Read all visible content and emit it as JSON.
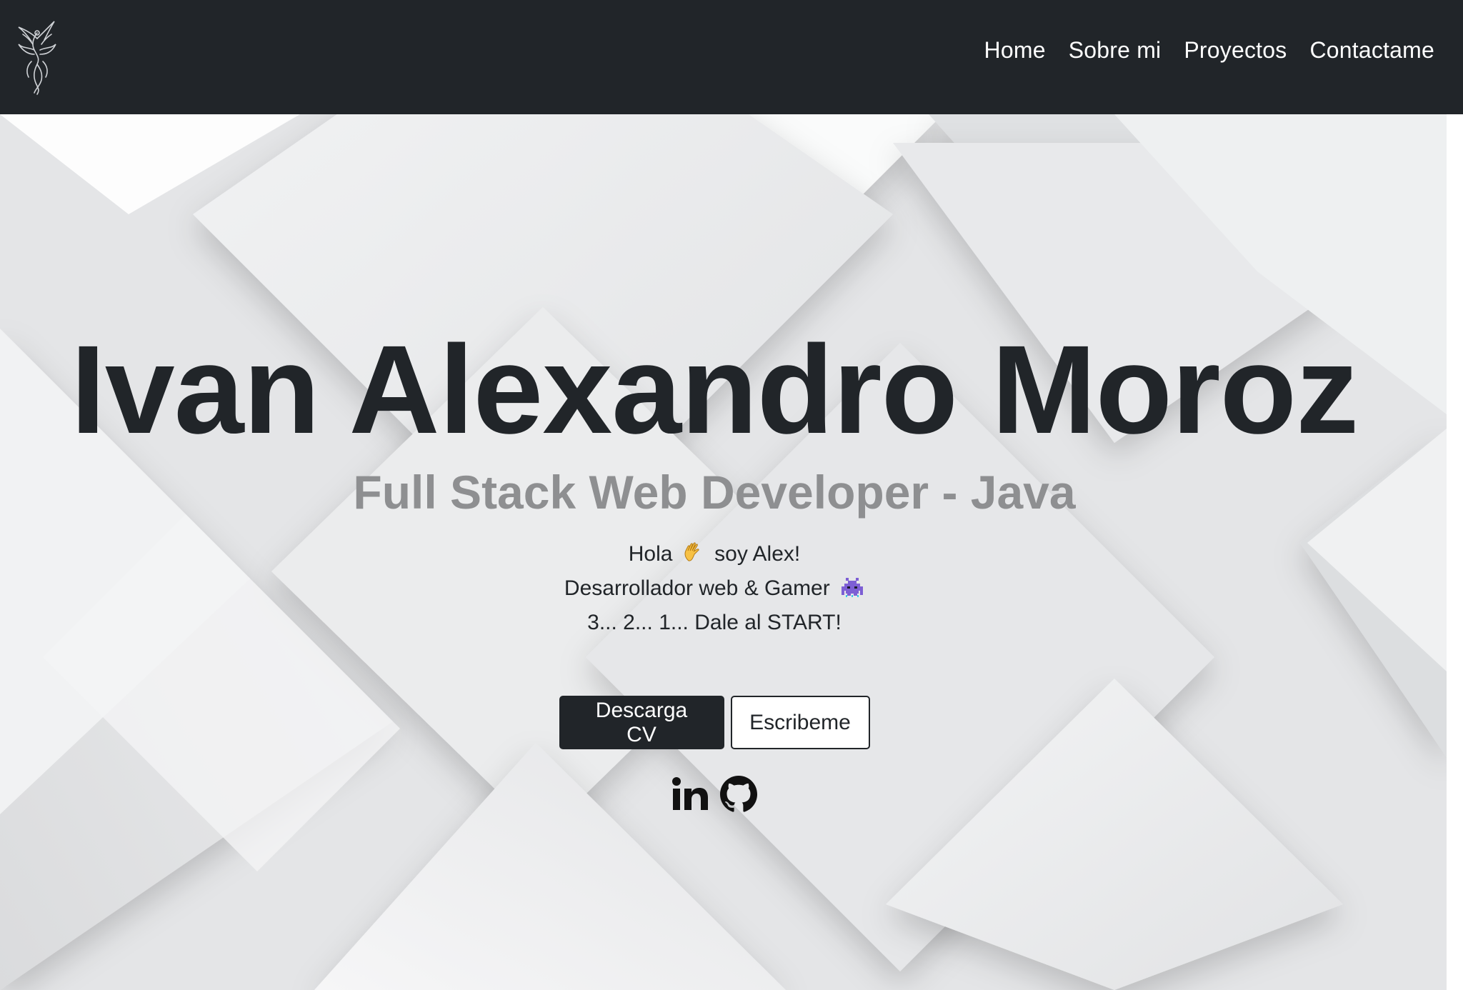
{
  "navbar": {
    "logo": "phoenix-logo",
    "links": [
      {
        "label": "Home"
      },
      {
        "label": "Sobre mi"
      },
      {
        "label": "Proyectos"
      },
      {
        "label": "Contactame"
      }
    ]
  },
  "hero": {
    "title": "Ivan Alexandro Moroz",
    "subtitle": "Full Stack Web Developer - Java",
    "intro": {
      "line1_before": "Hola",
      "line1_after": "soy Alex!",
      "line2": "Desarrollador web & Gamer",
      "line3": "3... 2... 1... Dale al START!"
    },
    "buttons": {
      "download_cv": "Descarga CV",
      "write_me": "Escribeme"
    },
    "social": [
      "linkedin-icon",
      "github-icon"
    ]
  },
  "colors": {
    "navbar_bg": "#212529",
    "text_dark": "#212529",
    "subtitle_gray": "#8e8f91",
    "hero_bg": "#e7e8ea"
  }
}
